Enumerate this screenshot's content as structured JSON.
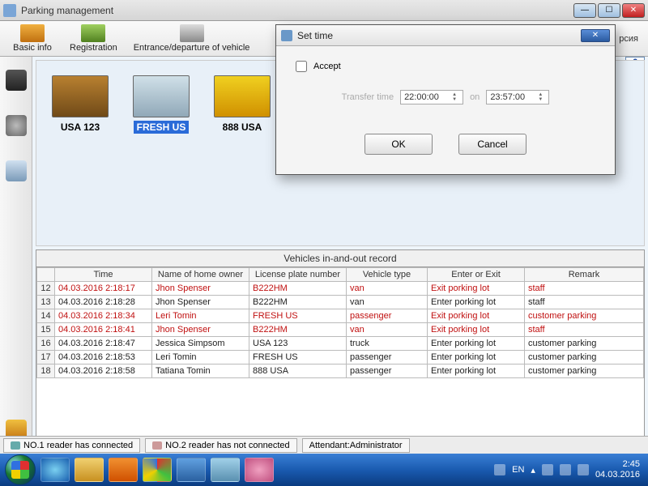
{
  "window": {
    "title": "Parking management"
  },
  "toolbar": {
    "items": [
      {
        "label": "Basic info",
        "color": "#d8a030"
      },
      {
        "label": "Registration",
        "color": "#7aa84a"
      },
      {
        "label": "Entrance/departure of vehicle",
        "color": "#555"
      }
    ],
    "overflow_text": "рсия"
  },
  "counter_top_right": "6",
  "thumbnails": [
    {
      "caption": "USA 123",
      "selected": false,
      "bg": "linear-gradient(#b88030,#704a18)"
    },
    {
      "caption": "FRESH US",
      "selected": true,
      "bg": "linear-gradient(#d0e0e8,#90a8b8)"
    },
    {
      "caption": "888 USA",
      "selected": false,
      "bg": "linear-gradient(#f0d020,#d09000)"
    }
  ],
  "table": {
    "title": "Vehicles in-and-out record",
    "columns": [
      "Time",
      "Name of home owner",
      "License plate number",
      "Vehicle type",
      "Enter or Exit",
      "Remark"
    ],
    "rows": [
      {
        "n": "12",
        "time": "04.03.2016 2:18:17",
        "owner": "Jhon Spenser",
        "plate": "B222HM",
        "vtype": "van",
        "dir": "Exit porking lot",
        "remark": "staff",
        "cls": "exit"
      },
      {
        "n": "13",
        "time": "04.03.2016 2:18:28",
        "owner": "Jhon Spenser",
        "plate": "B222HM",
        "vtype": "van",
        "dir": "Enter porking lot",
        "remark": "staff",
        "cls": "enter"
      },
      {
        "n": "14",
        "time": "04.03.2016 2:18:34",
        "owner": "Leri Tomin",
        "plate": "FRESH US",
        "vtype": "passenger",
        "dir": "Exit porking lot",
        "remark": "customer parking",
        "cls": "exit"
      },
      {
        "n": "15",
        "time": "04.03.2016 2:18:41",
        "owner": "Jhon Spenser",
        "plate": "B222HM",
        "vtype": "van",
        "dir": "Exit porking lot",
        "remark": "staff",
        "cls": "exit"
      },
      {
        "n": "16",
        "time": "04.03.2016 2:18:47",
        "owner": "Jessica Simpsom",
        "plate": "USA 123",
        "vtype": "truck",
        "dir": "Enter porking lot",
        "remark": "customer parking",
        "cls": "enter"
      },
      {
        "n": "17",
        "time": "04.03.2016 2:18:53",
        "owner": "Leri Tomin",
        "plate": "FRESH US",
        "vtype": "passenger",
        "dir": "Enter porking lot",
        "remark": "customer parking",
        "cls": "enter"
      },
      {
        "n": "18",
        "time": "04.03.2016 2:18:58",
        "owner": "Tatiana Tomin",
        "plate": "888 USA",
        "vtype": "passenger",
        "dir": "Enter porking lot",
        "remark": "customer parking",
        "cls": "enter"
      }
    ]
  },
  "statusbar": {
    "reader1": "NO.1 reader has connected",
    "reader2": "NO.2 reader has not connected",
    "attendant": "Attendant:Administrator"
  },
  "dialog": {
    "title": "Set time",
    "accept_label": "Accept",
    "transfer_label": "Transfer time",
    "time1": "22:00:00",
    "on_label": "on",
    "time2": "23:57:00",
    "ok": "OK",
    "cancel": "Cancel"
  },
  "taskbar": {
    "lang": "EN",
    "time": "2:45",
    "date": "04.03.2016"
  }
}
